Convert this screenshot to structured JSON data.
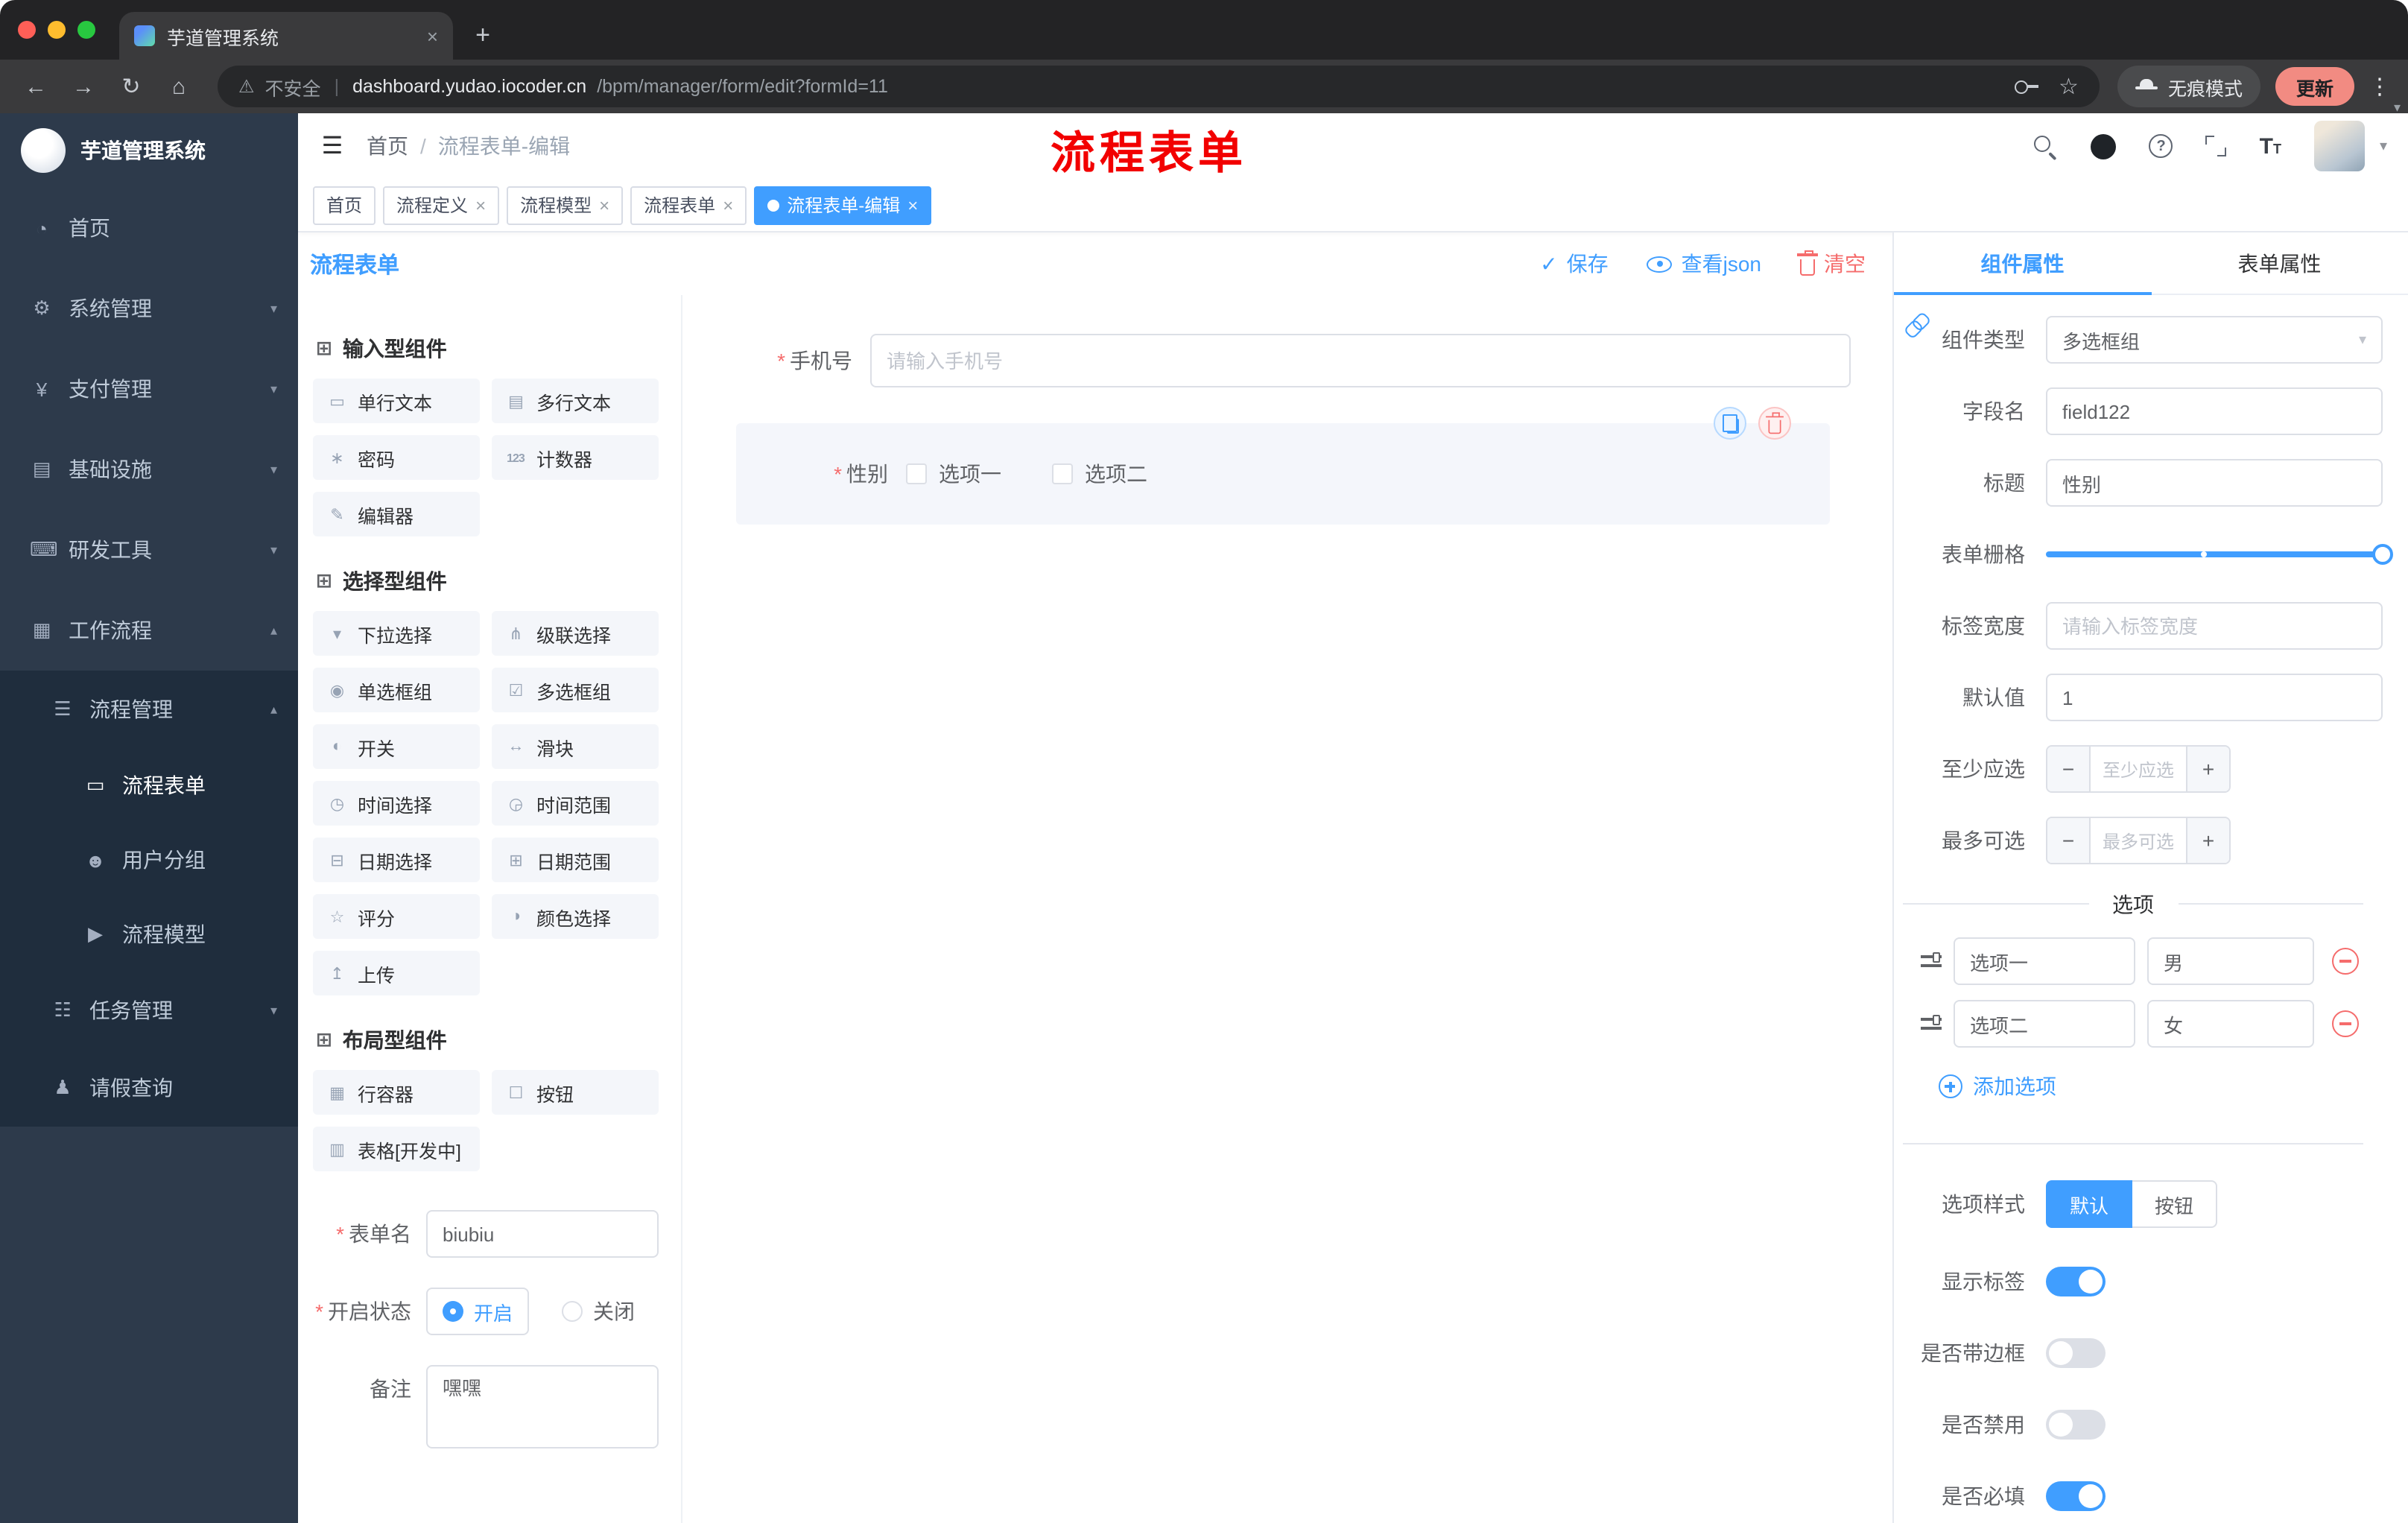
{
  "glyphs": {
    "close": "×",
    "plus": "+",
    "minus": "−",
    "kebab": "⋮",
    "caret_down": "▾",
    "caret_up": "▴",
    "check": "✓",
    "hamburger": "☰",
    "warning": "⚠",
    "star": "☆",
    "pipe": "|",
    "slash": "/",
    "back": "←",
    "forward": "→",
    "reload": "↻",
    "home": "⌂",
    "asterisk": "*",
    "question": "?",
    "T_big": "T",
    "T_small": "T"
  },
  "colors": {
    "primary": "#409eff",
    "danger": "#f56c6c",
    "sidebar": "#2d3a4b",
    "sidebar_sub": "#1f2d3d"
  },
  "browser": {
    "tab_title": "芋道管理系统",
    "secure_label": "不安全",
    "url_domain": "dashboard.yudao.iocoder.cn",
    "url_path": "/bpm/manager/form/edit?formId=11",
    "incognito_label": "无痕模式",
    "update_label": "更新"
  },
  "sidebar": {
    "logo_title": "芋道管理系统",
    "items": [
      {
        "label": "首页",
        "glyph": "◔"
      },
      {
        "label": "系统管理",
        "glyph": "⚙"
      },
      {
        "label": "支付管理",
        "glyph": "¥"
      },
      {
        "label": "基础设施",
        "glyph": "▤"
      },
      {
        "label": "研发工具",
        "glyph": "⌨"
      },
      {
        "label": "工作流程",
        "glyph": "▦"
      },
      {
        "label": "流程管理",
        "glyph": "☰"
      },
      {
        "label": "流程表单",
        "glyph": "▭"
      },
      {
        "label": "用户分组",
        "glyph": "☻"
      },
      {
        "label": "流程模型",
        "glyph": "▶"
      },
      {
        "label": "任务管理",
        "glyph": "☷"
      },
      {
        "label": "请假查询",
        "glyph": "♟"
      }
    ]
  },
  "header": {
    "breadcrumb_home": "首页",
    "breadcrumb_current": "流程表单-编辑",
    "annotation": "流程表单"
  },
  "tags": [
    {
      "label": "首页"
    },
    {
      "label": "流程定义"
    },
    {
      "label": "流程模型"
    },
    {
      "label": "流程表单"
    },
    {
      "label": "流程表单-编辑"
    }
  ],
  "designer": {
    "title": "流程表单",
    "save_label": "保存",
    "view_json_label": "查看json",
    "clear_label": "清空"
  },
  "palette": {
    "sections": [
      {
        "title": "输入型组件",
        "icon": "⊞",
        "items": [
          {
            "label": "单行文本",
            "glyph": "▭"
          },
          {
            "label": "多行文本",
            "glyph": "▤"
          },
          {
            "label": "密码",
            "glyph": "∗"
          },
          {
            "label": "计数器",
            "glyph": "123"
          },
          {
            "label": "编辑器",
            "glyph": "✎"
          }
        ]
      },
      {
        "title": "选择型组件",
        "icon": "⊞",
        "items": [
          {
            "label": "下拉选择",
            "glyph": "▾"
          },
          {
            "label": "级联选择",
            "glyph": "⋔"
          },
          {
            "label": "单选框组",
            "glyph": "◉"
          },
          {
            "label": "多选框组",
            "glyph": "☑"
          },
          {
            "label": "开关",
            "glyph": "◐"
          },
          {
            "label": "滑块",
            "glyph": "↔"
          },
          {
            "label": "时间选择",
            "glyph": "◷"
          },
          {
            "label": "时间范围",
            "glyph": "◶"
          },
          {
            "label": "日期选择",
            "glyph": "⊟"
          },
          {
            "label": "日期范围",
            "glyph": "⊞"
          },
          {
            "label": "评分",
            "glyph": "☆"
          },
          {
            "label": "颜色选择",
            "glyph": "◑"
          },
          {
            "label": "上传",
            "glyph": "↥"
          }
        ]
      },
      {
        "title": "布局型组件",
        "icon": "⊞",
        "items": [
          {
            "label": "行容器",
            "glyph": "▦"
          },
          {
            "label": "按钮",
            "glyph": "☐"
          },
          {
            "label": "表格[开发中]",
            "glyph": "▥"
          }
        ]
      }
    ]
  },
  "form_meta": {
    "name_label": "表单名",
    "name_value": "biubiu",
    "status_label": "开启状态",
    "status_on": "开启",
    "status_off": "关闭",
    "remark_label": "备注",
    "remark_value": "嘿嘿"
  },
  "canvas": {
    "phone_label": "手机号",
    "phone_placeholder": "请输入手机号",
    "gender_label": "性别",
    "gender_option1": "选项一",
    "gender_option2": "选项二"
  },
  "props": {
    "tab_component": "组件属性",
    "tab_form": "表单属性",
    "type_label": "组件类型",
    "type_value": "多选框组",
    "field_label": "字段名",
    "field_value": "field122",
    "title_label": "标题",
    "title_value": "性别",
    "grid_label": "表单栅格",
    "tagwidth_label": "标签宽度",
    "tagwidth_placeholder": "请输入标签宽度",
    "default_label": "默认值",
    "default_value": "1",
    "min_label": "至少应选",
    "min_placeholder": "至少应选",
    "max_label": "最多可选",
    "max_placeholder": "最多可选",
    "options_divider": "选项",
    "options": [
      {
        "label": "选项一",
        "value": "男"
      },
      {
        "label": "选项二",
        "value": "女"
      }
    ],
    "add_option_label": "添加选项",
    "style_label": "选项样式",
    "style_default": "默认",
    "style_button": "按钮",
    "show_label": "显示标签",
    "border_label": "是否带边框",
    "disabled_label": "是否禁用",
    "required_label": "是否必填"
  }
}
